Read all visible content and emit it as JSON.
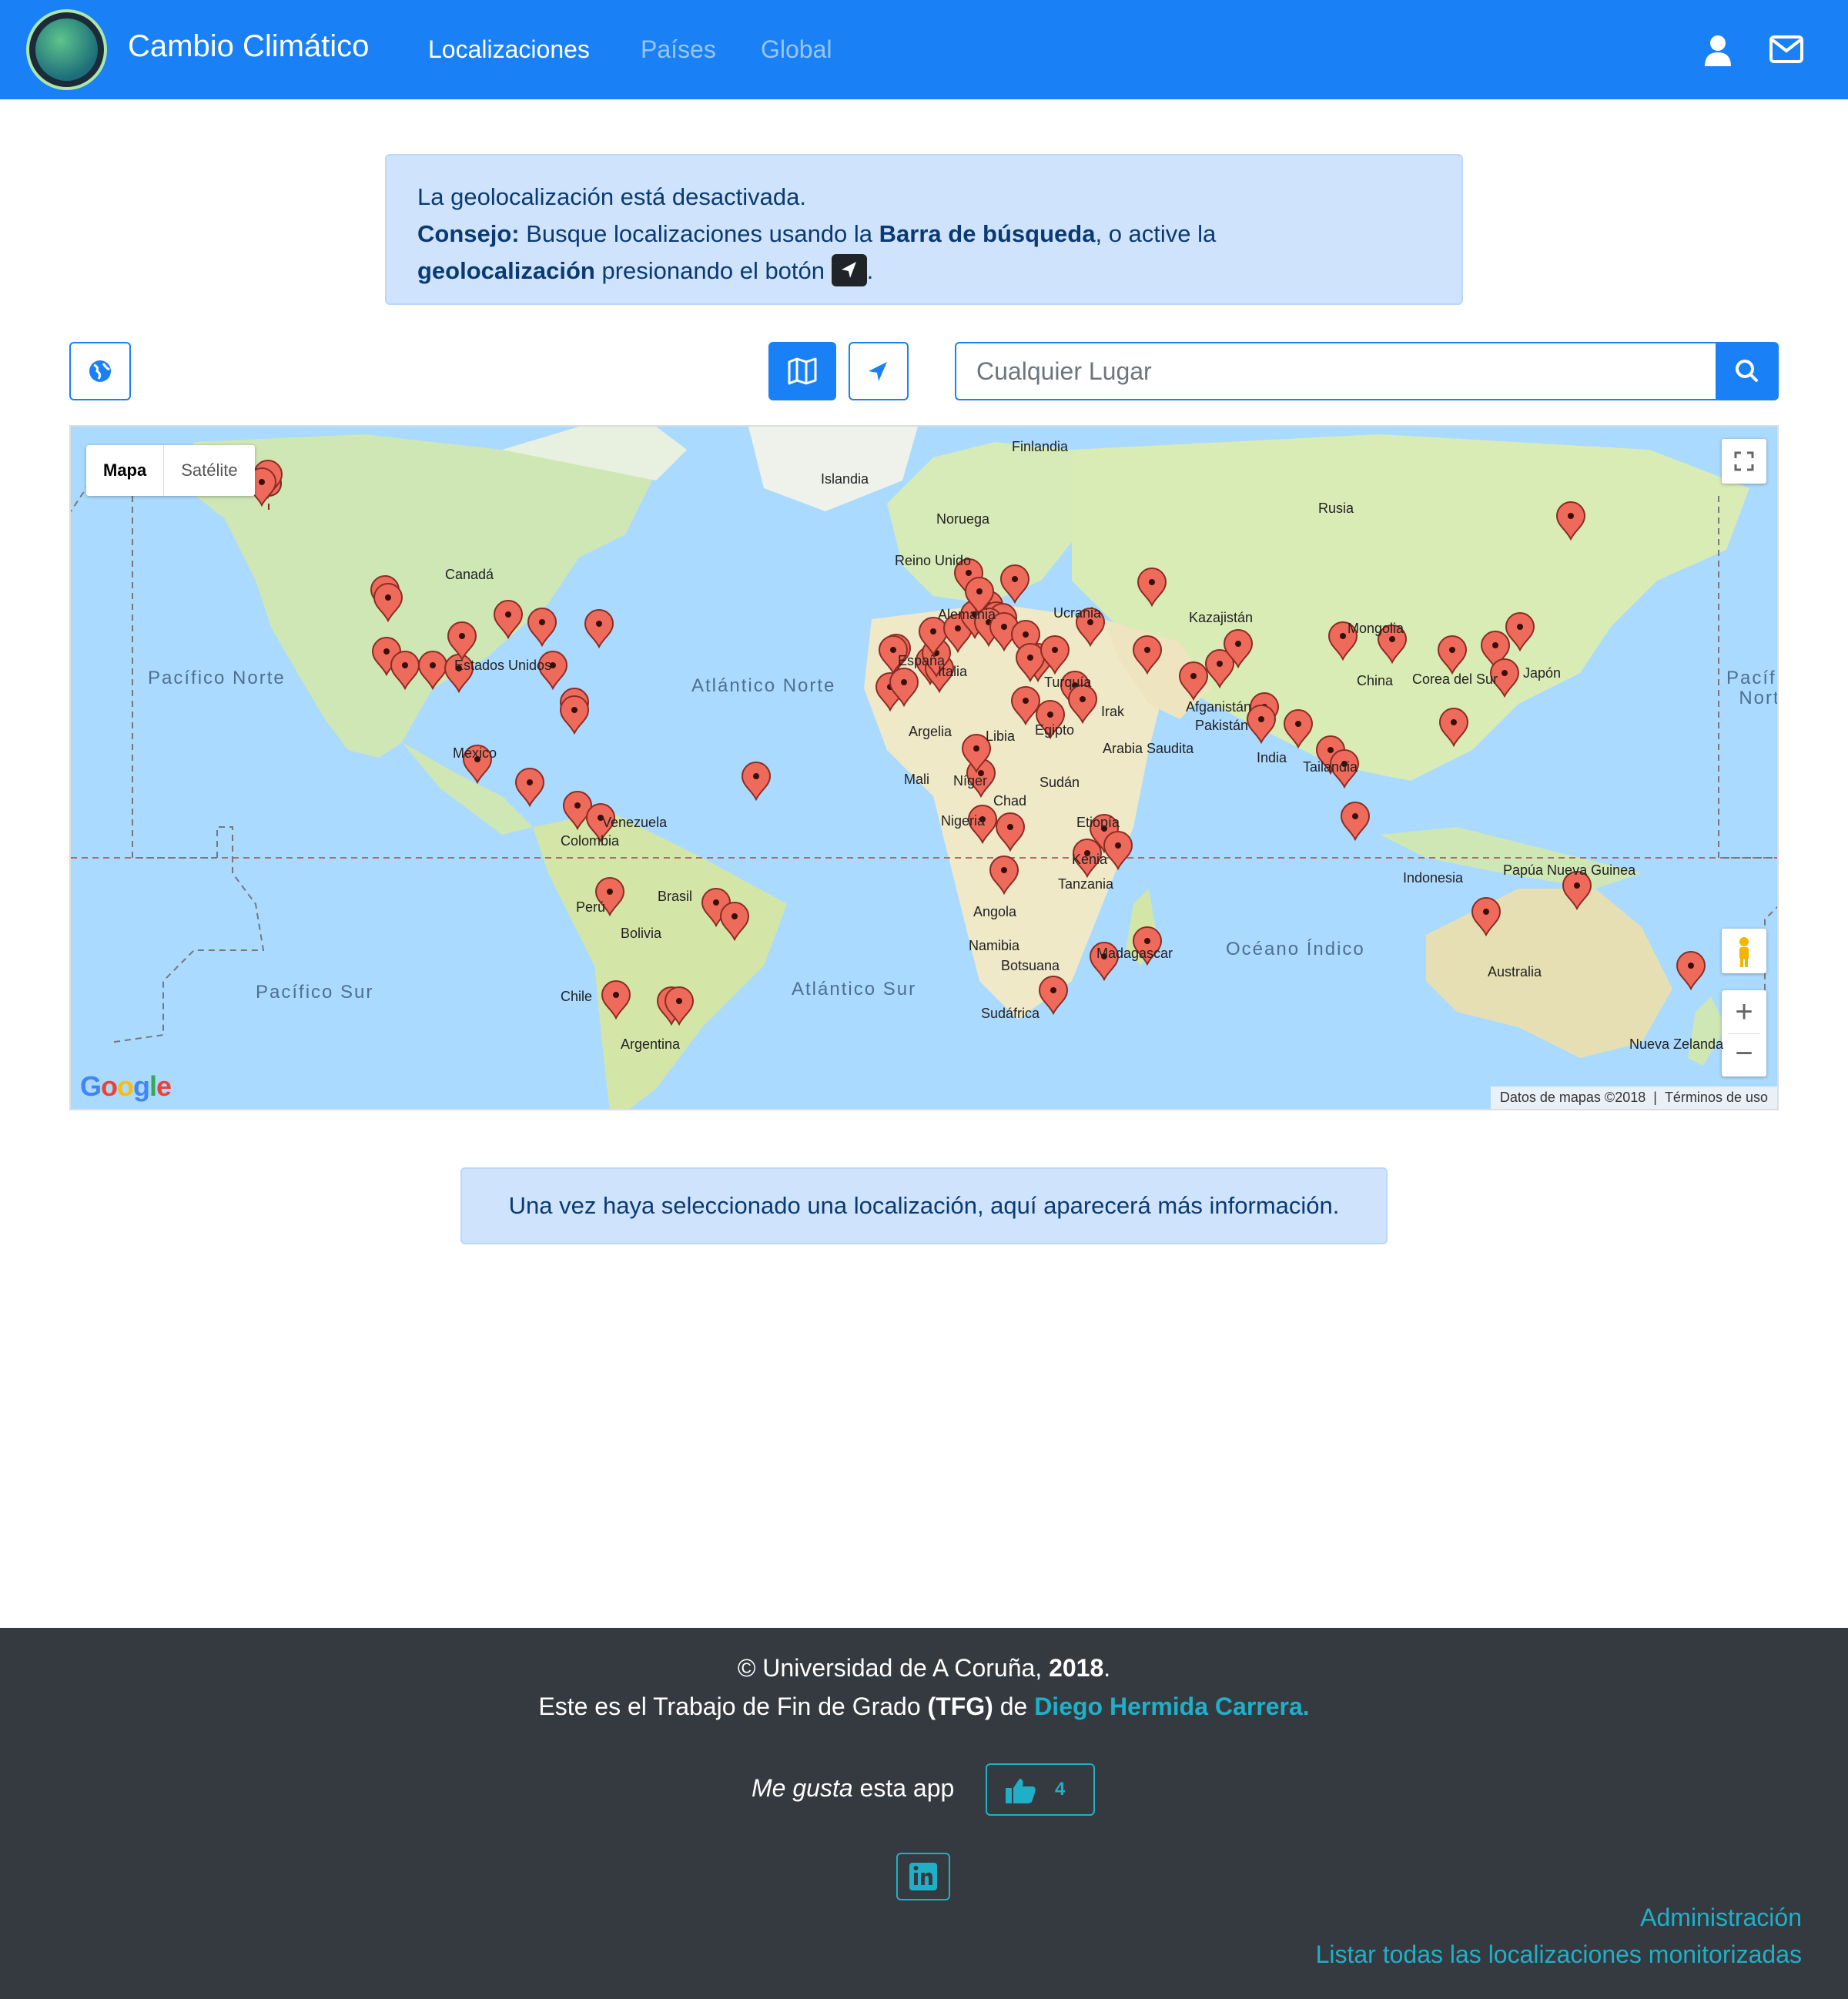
{
  "navbar": {
    "brand": "Cambio Climático",
    "links": [
      {
        "label": "Localizaciones",
        "active": true
      },
      {
        "label": "Países",
        "active": false
      },
      {
        "label": "Global",
        "active": false
      }
    ],
    "icons": [
      "user-icon",
      "envelope-icon"
    ],
    "color": "#1a80f6"
  },
  "geo_alert": {
    "line1": "La geolocalización está desactivada.",
    "tip_label": "Consejo:",
    "tip_text_1": " Busque localizaciones usando la ",
    "tip_bold_1": "Barra de búsqueda",
    "tip_text_2": ", o active la",
    "tip_bold_2": "geolocalización",
    "tip_text_3": " presionando el botón ",
    "tip_end": "."
  },
  "toolbar": {
    "globe_button_icon": "globe-icon",
    "map_button_icon": "map-icon",
    "locate_button_icon": "location-arrow-icon",
    "search_placeholder": "Cualquier Lugar",
    "search_button_icon": "search-icon"
  },
  "map": {
    "type_options": [
      "Mapa",
      "Satélite"
    ],
    "selected_type": "Mapa",
    "attribution": "Datos de mapas ©2018",
    "terms": "Términos de uso",
    "logo": "Google",
    "country_labels": [
      "Finlandia",
      "Islandia",
      "Noruega",
      "Rusia",
      "Canadá",
      "Reino Unido",
      "Alemania",
      "Ucrania",
      "Kazajistán",
      "Mongolia",
      "Estados Unidos",
      "España",
      "Italia",
      "Turquía",
      "Irak",
      "Afganistán",
      "China",
      "Corea del Sur",
      "Japón",
      "Pakistán",
      "India",
      "México",
      "Argelia",
      "Libia",
      "Egipto",
      "Arabia Saudita",
      "Tailandia",
      "Mali",
      "Níger",
      "Chad",
      "Sudán",
      "Venezuela",
      "Colombia",
      "Nigeria",
      "Etiopía",
      "Kenia",
      "Indonesia",
      "Papúa Nueva Guinea",
      "Perú",
      "Brasil",
      "Bolivia",
      "Tanzania",
      "Angola",
      "Namibia",
      "Botsuana",
      "Madagascar",
      "Australia",
      "Chile",
      "Argentina",
      "Sudáfrica",
      "Nueva Zelanda"
    ],
    "ocean_labels": [
      "Pacífico Norte",
      "Atlántico Norte",
      "Atlántico Sur",
      "Pacífico Sur",
      "Océano Índico",
      "Pacífico Norte"
    ],
    "zoom_in": "+",
    "zoom_out": "−"
  },
  "selection_alert": "Una vez haya seleccionado una localización, aquí aparecerá más información.",
  "footer": {
    "copyright_prefix": "© Universidad de A Coruña, ",
    "year": "2018",
    "copyright_suffix": ".",
    "tfg_text": "Este es el Trabajo de Fin de Grado ",
    "tfg_bold": "(TFG)",
    "tfg_de": " de ",
    "author": "Diego Hermida Carrera.",
    "like_prefix_italic": "Me gusta",
    "like_suffix": " esta app",
    "like_count": "4",
    "admin_link": "Administración",
    "list_link": "Listar todas las localizaciones monitorizadas"
  }
}
